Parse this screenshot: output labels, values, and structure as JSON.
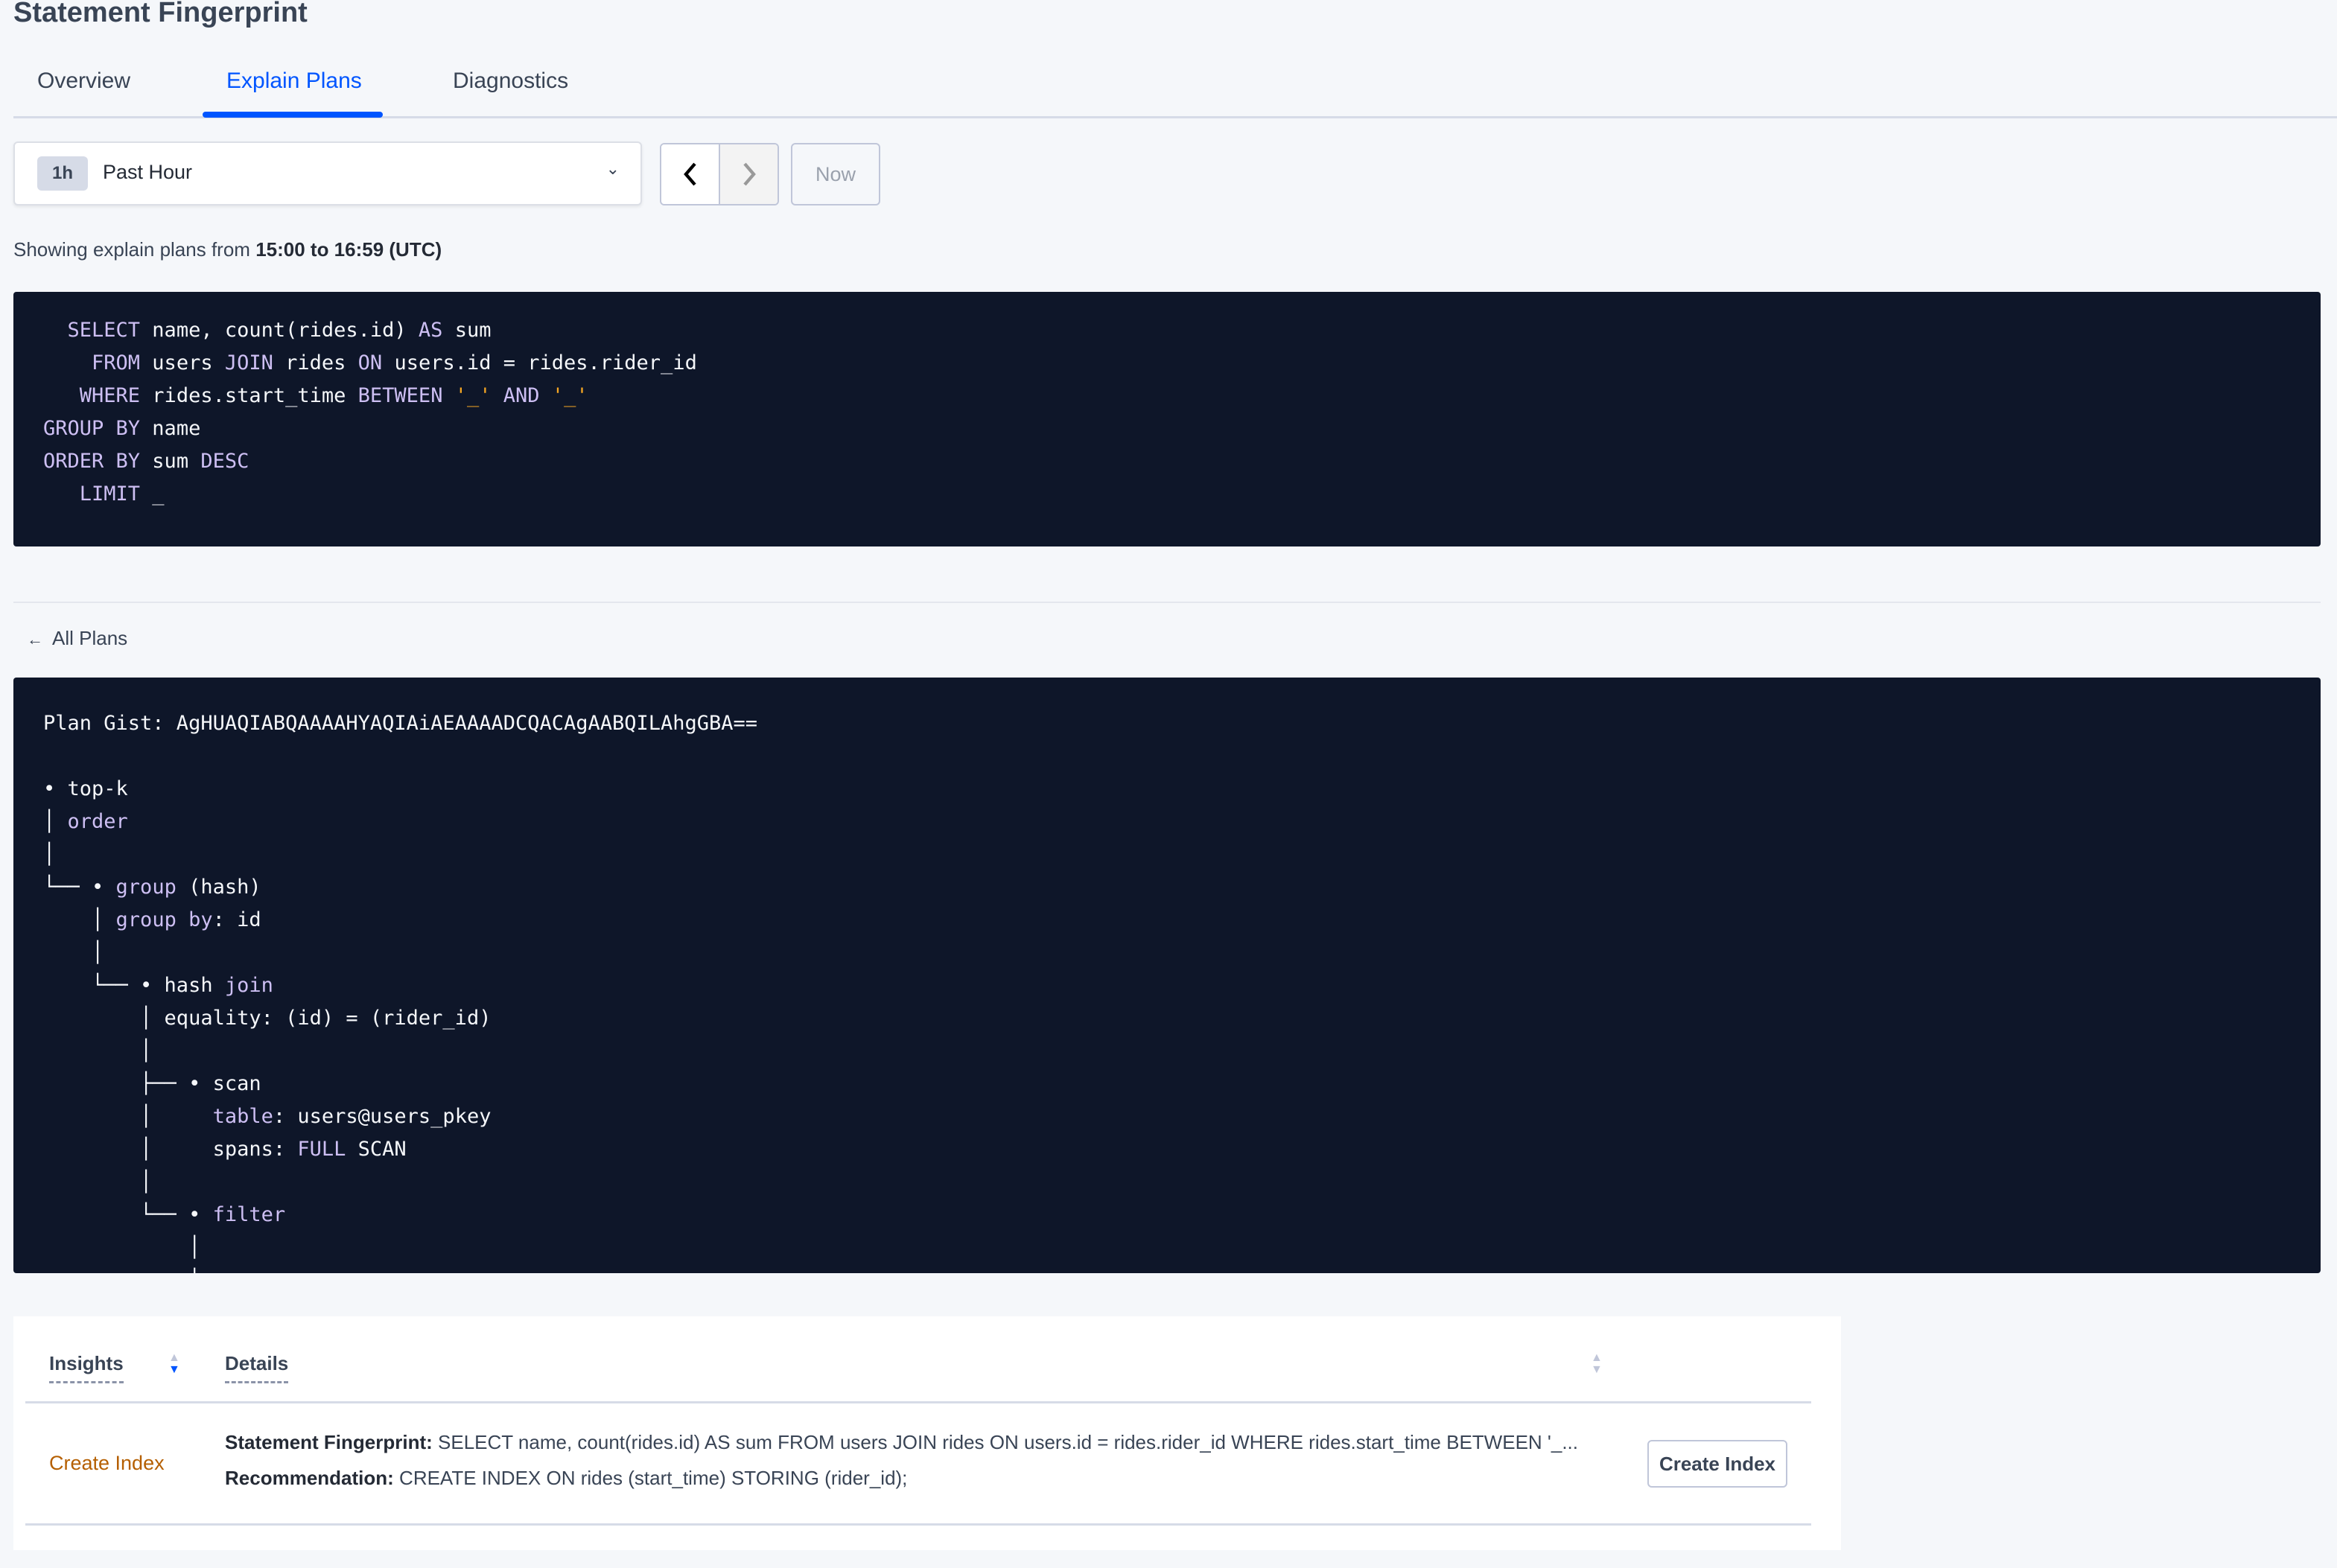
{
  "page_title": "Statement Fingerprint",
  "tabs": [
    {
      "label": "Overview",
      "active": false
    },
    {
      "label": "Explain Plans",
      "active": true
    },
    {
      "label": "Diagnostics",
      "active": false
    }
  ],
  "time_picker": {
    "badge": "1h",
    "selected": "Past Hour",
    "prev_icon": "chevron-left-icon",
    "next_icon": "chevron-right-icon",
    "now_label": "Now"
  },
  "showing": {
    "prefix": "Showing explain plans from ",
    "range": "15:00 to 16:59 (UTC)"
  },
  "colors": {
    "accent": "#0055ff",
    "code_bg": "#0e1629",
    "keyword": "#cdbff3",
    "string": "#f5a623",
    "insight": "#b55f00"
  },
  "sql_lines": [
    [
      [
        "  SELECT",
        "k"
      ],
      [
        " name, count(rides.id) ",
        ""
      ],
      [
        "AS",
        "k"
      ],
      [
        " sum",
        ""
      ]
    ],
    [
      [
        "    FROM",
        "k"
      ],
      [
        " users ",
        ""
      ],
      [
        "JOIN",
        "k"
      ],
      [
        " rides ",
        ""
      ],
      [
        "ON",
        "k"
      ],
      [
        " users.id = rides.rider_id",
        ""
      ]
    ],
    [
      [
        "   WHERE",
        "k"
      ],
      [
        " rides.start_time ",
        ""
      ],
      [
        "BETWEEN",
        "k"
      ],
      [
        " ",
        ""
      ],
      [
        "'_'",
        "s"
      ],
      [
        " ",
        ""
      ],
      [
        "AND",
        "k"
      ],
      [
        " ",
        ""
      ],
      [
        "'_'",
        "s"
      ]
    ],
    [
      [
        "GROUP BY",
        "k"
      ],
      [
        " name",
        ""
      ]
    ],
    [
      [
        "ORDER BY",
        "k"
      ],
      [
        " sum ",
        ""
      ],
      [
        "DESC",
        "k"
      ]
    ],
    [
      [
        "   LIMIT",
        "k"
      ],
      [
        " _",
        ""
      ]
    ]
  ],
  "all_plans_label": "All Plans",
  "plan_lines": [
    [
      [
        "Plan Gist: AgHUAQIABQAAAAHYAQIAiAEAAAADCQACAgAABQILAhgGBA==",
        ""
      ]
    ],
    [],
    [
      [
        "• top-k",
        ""
      ]
    ],
    [
      [
        "│ ",
        ""
      ],
      [
        "order",
        "k"
      ]
    ],
    [
      [
        "│",
        ""
      ]
    ],
    [
      [
        "└── • ",
        ""
      ],
      [
        "group",
        "k"
      ],
      [
        " (hash)",
        ""
      ]
    ],
    [
      [
        "    │ ",
        ""
      ],
      [
        "group by",
        "k"
      ],
      [
        ": id",
        ""
      ]
    ],
    [
      [
        "    │",
        ""
      ]
    ],
    [
      [
        "    └── • hash ",
        ""
      ],
      [
        "join",
        "k"
      ]
    ],
    [
      [
        "        │ equality: (id) = (rider_id)",
        ""
      ]
    ],
    [
      [
        "        │",
        ""
      ]
    ],
    [
      [
        "        ├── • scan",
        ""
      ]
    ],
    [
      [
        "        │     ",
        ""
      ],
      [
        "table",
        "k"
      ],
      [
        ": users@users_pkey",
        ""
      ]
    ],
    [
      [
        "        │     spans: ",
        ""
      ],
      [
        "FULL",
        "k"
      ],
      [
        " SCAN",
        ""
      ]
    ],
    [
      [
        "        │",
        ""
      ]
    ],
    [
      [
        "        └── • ",
        ""
      ],
      [
        "filter",
        "k"
      ]
    ],
    [
      [
        "            │",
        ""
      ]
    ],
    [
      [
        "            │",
        ""
      ]
    ]
  ],
  "insights_table": {
    "headers": [
      "Insights",
      "Details"
    ],
    "rows": [
      {
        "insight": "Create Index",
        "fingerprint_label": "Statement Fingerprint:",
        "fingerprint": " SELECT name, count(rides.id) AS sum FROM users JOIN rides ON users.id = rides.rider_id WHERE rides.start_time BETWEEN '_...",
        "recommendation_label": "Recommendation:",
        "recommendation": " CREATE INDEX ON rides (start_time) STORING (rider_id);",
        "action": "Create Index"
      }
    ]
  }
}
